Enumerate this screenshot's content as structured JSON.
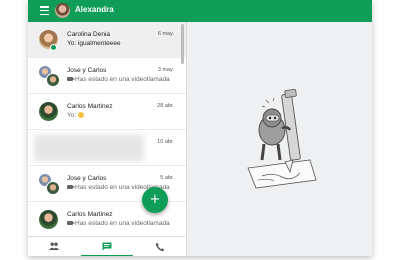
{
  "header": {
    "user_name": "Alexandra",
    "menu_icon": "hamburger-menu-icon"
  },
  "conversations": [
    {
      "name": "Carolina Denia",
      "date": "6 may.",
      "preview": "Yo: igualmenteeee",
      "avatar": "carolina",
      "online": true,
      "selected": true
    },
    {
      "name": "Jose y Carlos",
      "date": "3 may.",
      "preview": "Has estado en una videollamada",
      "avatar": "group",
      "video": true
    },
    {
      "name": "Carlos Martinez",
      "date": "28 abr.",
      "preview": "Yo: ",
      "avatar": "carlos",
      "emoji": true
    },
    {
      "name": "",
      "date": "10 abr.",
      "preview": "",
      "blurred": true
    },
    {
      "name": "Jose y Carlos",
      "date": "5 abr.",
      "preview": "Has estado en una videollamada",
      "avatar": "group",
      "video": true
    },
    {
      "name": "Carlos Martinez",
      "date": "",
      "preview": "Has estado en una videollamada",
      "avatar": "carlos",
      "video": true
    }
  ],
  "fab": {
    "symbol": "+"
  },
  "bottom_nav": [
    {
      "name": "contacts",
      "icon": "people-icon",
      "active": false
    },
    {
      "name": "messages",
      "icon": "message-icon",
      "active": true
    },
    {
      "name": "calls",
      "icon": "phone-icon",
      "active": false
    }
  ],
  "colors": {
    "brand": "#0f9d58",
    "panel": "#eef0f1"
  }
}
